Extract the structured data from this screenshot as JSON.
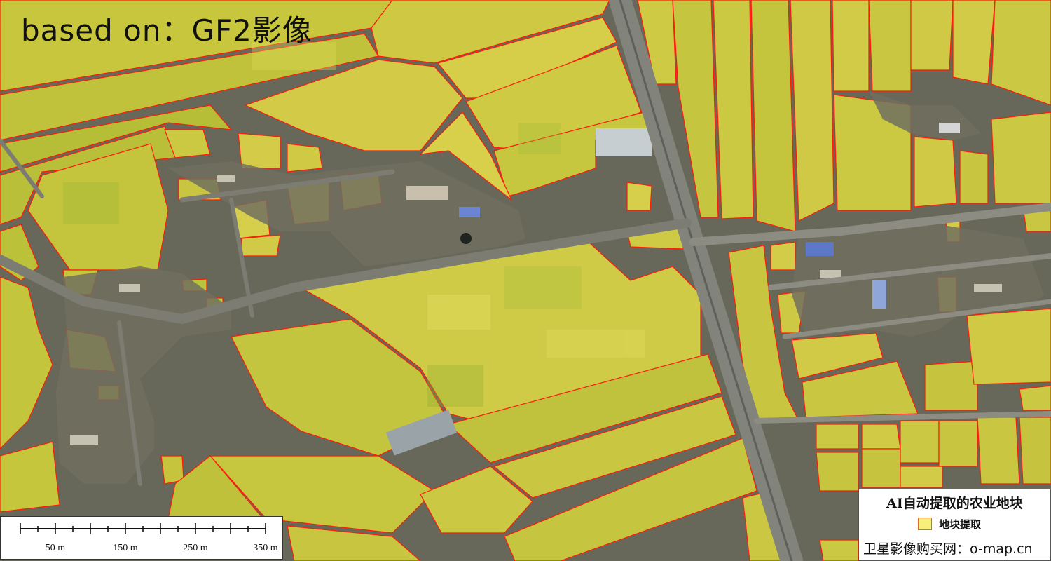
{
  "title": "based on：GF2影像",
  "colors": {
    "field_fill": "#c9c93a",
    "field_fill_light": "#e2dc55",
    "field_fill_green": "#a6b535",
    "field_outline": "#ff0000",
    "road": "#7d7f77",
    "village": "#6d6b60",
    "legend_swatch": "#f7ef7a"
  },
  "scale_bar": {
    "labels": [
      "50 m",
      "150 m",
      "250 m",
      "350 m"
    ]
  },
  "legend": {
    "title": "AI自动提取的农业地块",
    "items": [
      {
        "label": "地块提取"
      }
    ]
  },
  "source": "卫星影像购买网：o-map.cn"
}
